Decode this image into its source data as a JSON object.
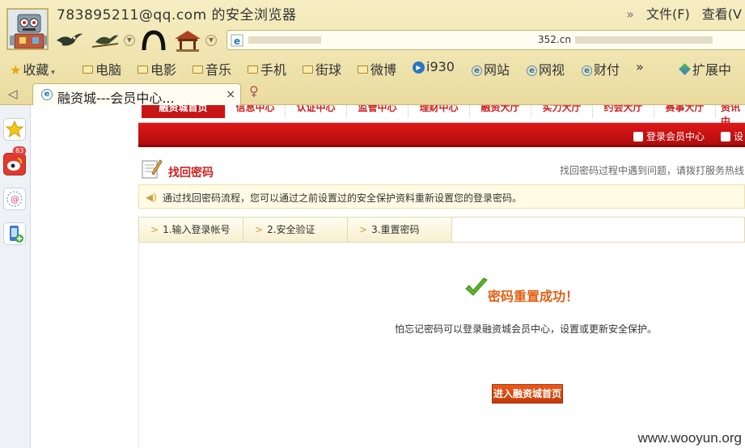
{
  "browser": {
    "account": "783895211@qq.com 的安全浏览器",
    "menus": {
      "more": "»",
      "file": "文件(F)",
      "view": "查看(V"
    },
    "address": {
      "url_fragment": "352.cn"
    },
    "favorites": {
      "collect": "收藏",
      "items": [
        "电脑",
        "电影",
        "音乐",
        "手机",
        "街球",
        "微博",
        "i930",
        "网站",
        "网视",
        "财付"
      ],
      "more": "»",
      "extensions": "扩展中"
    },
    "tab": {
      "title": "融资城---会员中心...",
      "close": "×"
    },
    "badge_count": "83"
  },
  "site": {
    "nav": [
      "融资城首页",
      "信息中心",
      "认证中心",
      "监管中心",
      "理财中心",
      "融资大厅",
      "实力大厅",
      "约会大厅",
      "赛事大厅",
      "资讯中"
    ],
    "sub_links": {
      "member_center": "登录会员中心",
      "settings": "设"
    },
    "title": "找回密码",
    "help_hint": "找回密码过程中遇到问题，请拨打服务热线",
    "notice": "通过找回密码流程，您可以通过之前设置过的安全保护资料重新设置您的登录密码。",
    "steps": [
      "1.输入登录帐号",
      "2.安全验证",
      "3.重置密码"
    ],
    "step_arrow": ">",
    "success": "密码重置成功！",
    "tip": "怕忘记密码可以登录融资城会员中心，设置或更新安全保护。",
    "enter_button": "进入融资城首页"
  },
  "watermark": "www.wooyun.org"
}
